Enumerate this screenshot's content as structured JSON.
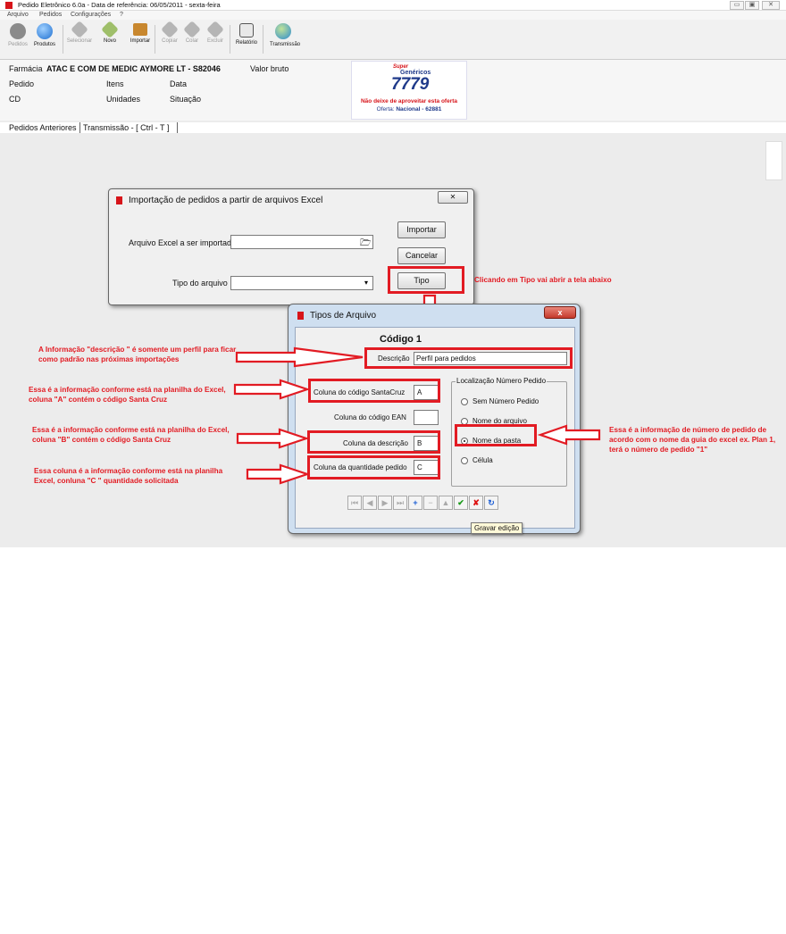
{
  "window": {
    "title": "Pedido Eletrônico 6.0a - Data de referência: 06/05/2011 - sexta-feira",
    "controls": [
      "▭",
      "▣",
      "✕"
    ]
  },
  "menu": [
    "Arquivo",
    "Pedidos",
    "Configurações",
    "?"
  ],
  "toolbar": {
    "pedidos": "Pedidos",
    "produtos": "Produtos",
    "selecionar": "Selecionar",
    "novo": "Novo",
    "importar": "Importar",
    "copiar": "Copiar",
    "colar": "Colar",
    "excluir": "Excluir",
    "relatorio": "Relatório",
    "transmissao": "Transmissão"
  },
  "info": {
    "farmacia_label": "Farmácia",
    "farmacia_value": "ATAC E COM DE MEDIC AYMORE LT - S82046",
    "valor_bruto": "Valor bruto",
    "pedido": "Pedido",
    "itens": "Itens",
    "data": "Data",
    "cd": "CD",
    "unidades": "Unidades",
    "situacao": "Situação"
  },
  "banner": {
    "brand_top": "Super",
    "brand_main": "Genéricos",
    "number": "7779",
    "line1": "Não deixe de aproveitar esta oferta",
    "line2_prefix": "Oferta: ",
    "line2_value": "Nacional - 62881"
  },
  "tabs": {
    "pedidos_anteriores": "Pedidos Anteriores",
    "transmissao": "Transmissão  -  [ Ctrl - T ]"
  },
  "import_dialog": {
    "title": "Importação de pedidos a partir de arquivos Excel",
    "close": "✕",
    "arquivo_label": "Arquivo Excel a ser importado",
    "arquivo_value": "",
    "tipo_label": "Tipo do arquivo",
    "tipo_value": "",
    "btn_importar": "Importar",
    "btn_cancelar": "Cancelar",
    "btn_tipo": "Tipo"
  },
  "tipos_dialog": {
    "title": "Tipos de Arquivo",
    "close": "x",
    "codigo": "Código  1",
    "descricao_label": "Descrição",
    "descricao_value": "Perfil para pedidos",
    "col_santacruz_label": "Coluna do código SantaCruz",
    "col_santacruz_value": "A",
    "col_ean_label": "Coluna do código EAN",
    "col_ean_value": "",
    "col_descricao_label": "Coluna da descrição",
    "col_descricao_value": "B",
    "col_quantidade_label": "Coluna da quantidade pedido",
    "col_quantidade_value": "C",
    "localizacao_title": "Localização Número Pedido",
    "options": [
      "Sem Número Pedido",
      "Nome do arquivo",
      "Nome da pasta",
      "Célula"
    ],
    "selected_option": "Nome da pasta",
    "tooltip": "Gravar edição"
  },
  "annotations": {
    "tipo": "Clicando em Tipo vai abrir a tela abaixo",
    "descricao": "A Informação \"descrição \" é somente um perfil para ficar como padrão nas próximas importações",
    "santacruz": "Essa é a informação conforme está na planilha do Excel, coluna \"A\" contém o código Santa Cruz",
    "desc_col": "Essa é a informação conforme está na planilha do Excel, coluna \"B\" contém o código Santa Cruz",
    "quantidade": "Essa coluna é a informação conforme está na planilha Excel, conluna \"C \" quantidade solicitada",
    "pasta": "Essa é a informação de número de pedido de acordo com o nome da guia do excel ex. Plan 1, terá o número de pedido \"1\""
  },
  "colors": {
    "annotation_red": "#e21b23",
    "banner_red": "#d7141a",
    "banner_blue": "#1f3a8a"
  }
}
